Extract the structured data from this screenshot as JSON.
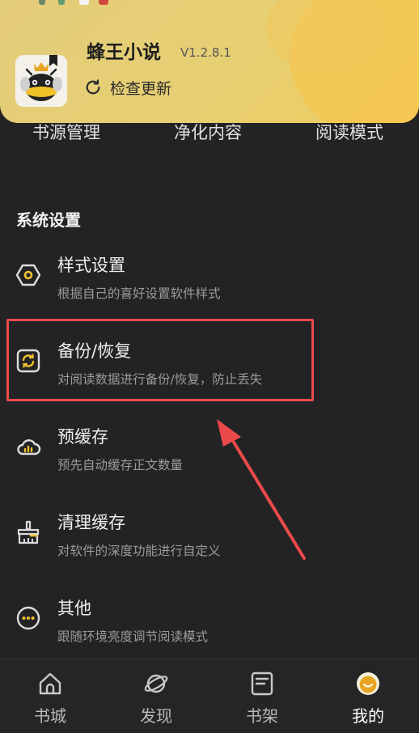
{
  "header": {
    "app_name": "蜂王小说",
    "version": "V1.2.8.1",
    "update_label": "检查更新",
    "logo_icon": "bee-king-logo-icon",
    "accent_color": "#e7cf73"
  },
  "tabs": [
    {
      "label": "书源管理"
    },
    {
      "label": "净化内容"
    },
    {
      "label": "阅读模式"
    }
  ],
  "section": {
    "title": "系统设置"
  },
  "settings_items": [
    {
      "title": "样式设置",
      "desc": "根据自己的喜好设置软件样式",
      "icon": "hexagon-style-icon"
    },
    {
      "title": "备份/恢复",
      "desc": "对阅读数据进行备份/恢复，防止丢失",
      "icon": "sync-backup-icon",
      "highlighted": true
    },
    {
      "title": "预缓存",
      "desc": "预先自动缓存正文数量",
      "icon": "cloud-chart-icon"
    },
    {
      "title": "清理缓存",
      "desc": "对软件的深度功能进行自定义",
      "icon": "broom-clean-icon"
    },
    {
      "title": "其他",
      "desc": "跟随环境亮度调节阅读模式",
      "icon": "more-dots-icon"
    }
  ],
  "bottom_nav": [
    {
      "label": "书城",
      "icon": "home-icon"
    },
    {
      "label": "发现",
      "icon": "planet-discover-icon"
    },
    {
      "label": "书架",
      "icon": "bookshelf-icon"
    },
    {
      "label": "我的",
      "icon": "avatar-icon",
      "active": true
    }
  ],
  "annotation": {
    "highlight_color": "#ec4a4a"
  }
}
